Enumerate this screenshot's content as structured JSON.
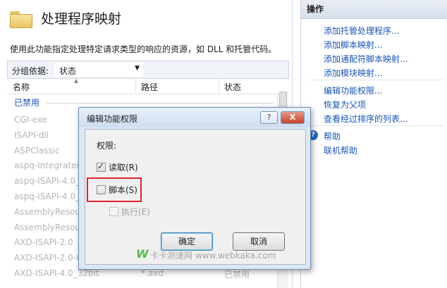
{
  "page": {
    "title": "处理程序映射",
    "description": "使用此功能指定处理特定请求类型的响应的资源，如 DLL 和托管代码。"
  },
  "groupbar": {
    "label": "分组依据:",
    "value": "状态"
  },
  "columns": {
    "name": "名称",
    "path": "路径",
    "state": "状态"
  },
  "group_header": "已禁用",
  "rows": [
    {
      "name": "CGI-exe",
      "path": "",
      "state": ""
    },
    {
      "name": "ISAPI-dll",
      "path": "",
      "state": ""
    },
    {
      "name": "ASPClassic",
      "path": "",
      "state": ""
    },
    {
      "name": "aspq-Integrated",
      "path": "",
      "state": ""
    },
    {
      "name": "aspq-ISAPI-4.0_",
      "path": "",
      "state": ""
    },
    {
      "name": "aspq-ISAPI-4.0_",
      "path": "",
      "state": ""
    },
    {
      "name": "AssemblyResou",
      "path": "",
      "state": ""
    },
    {
      "name": "AssemblyResou",
      "path": "",
      "state": ""
    },
    {
      "name": "AXD-ISAPI-2.0",
      "path": "",
      "state": ""
    },
    {
      "name": "AXD-ISAPI-2.0-6",
      "path": "",
      "state": ""
    },
    {
      "name": "AXD-ISAPI-4.0_32bit",
      "path": "*.axd",
      "state": "已禁用"
    }
  ],
  "actions": {
    "header": "操作",
    "group1": [
      "添加托管处理程序...",
      "添加脚本映射...",
      "添加通配符脚本映射...",
      "添加模块映射..."
    ],
    "group2": [
      "编辑功能权限...",
      "恢复为父项",
      "查看经过排序的列表..."
    ],
    "group3": [
      "帮助",
      "联机帮助"
    ]
  },
  "dialog": {
    "title": "编辑功能权限",
    "help_glyph": "?",
    "close_glyph": "X",
    "permissions_label": "权限:",
    "read": {
      "label": "读取(R)",
      "checked": true
    },
    "script": {
      "label": "脚本(S)",
      "checked": false
    },
    "execute": {
      "label": "执行(E)",
      "checked": false,
      "enabled": false
    },
    "ok": "确定",
    "cancel": "取消"
  },
  "watermark": {
    "mark": "W",
    "text": "卡卡测速网 www.webkaka.com"
  },
  "colors": {
    "link": "#1a55b5",
    "highlight": "#e0242c",
    "watermark_green": "#3fb13a"
  }
}
